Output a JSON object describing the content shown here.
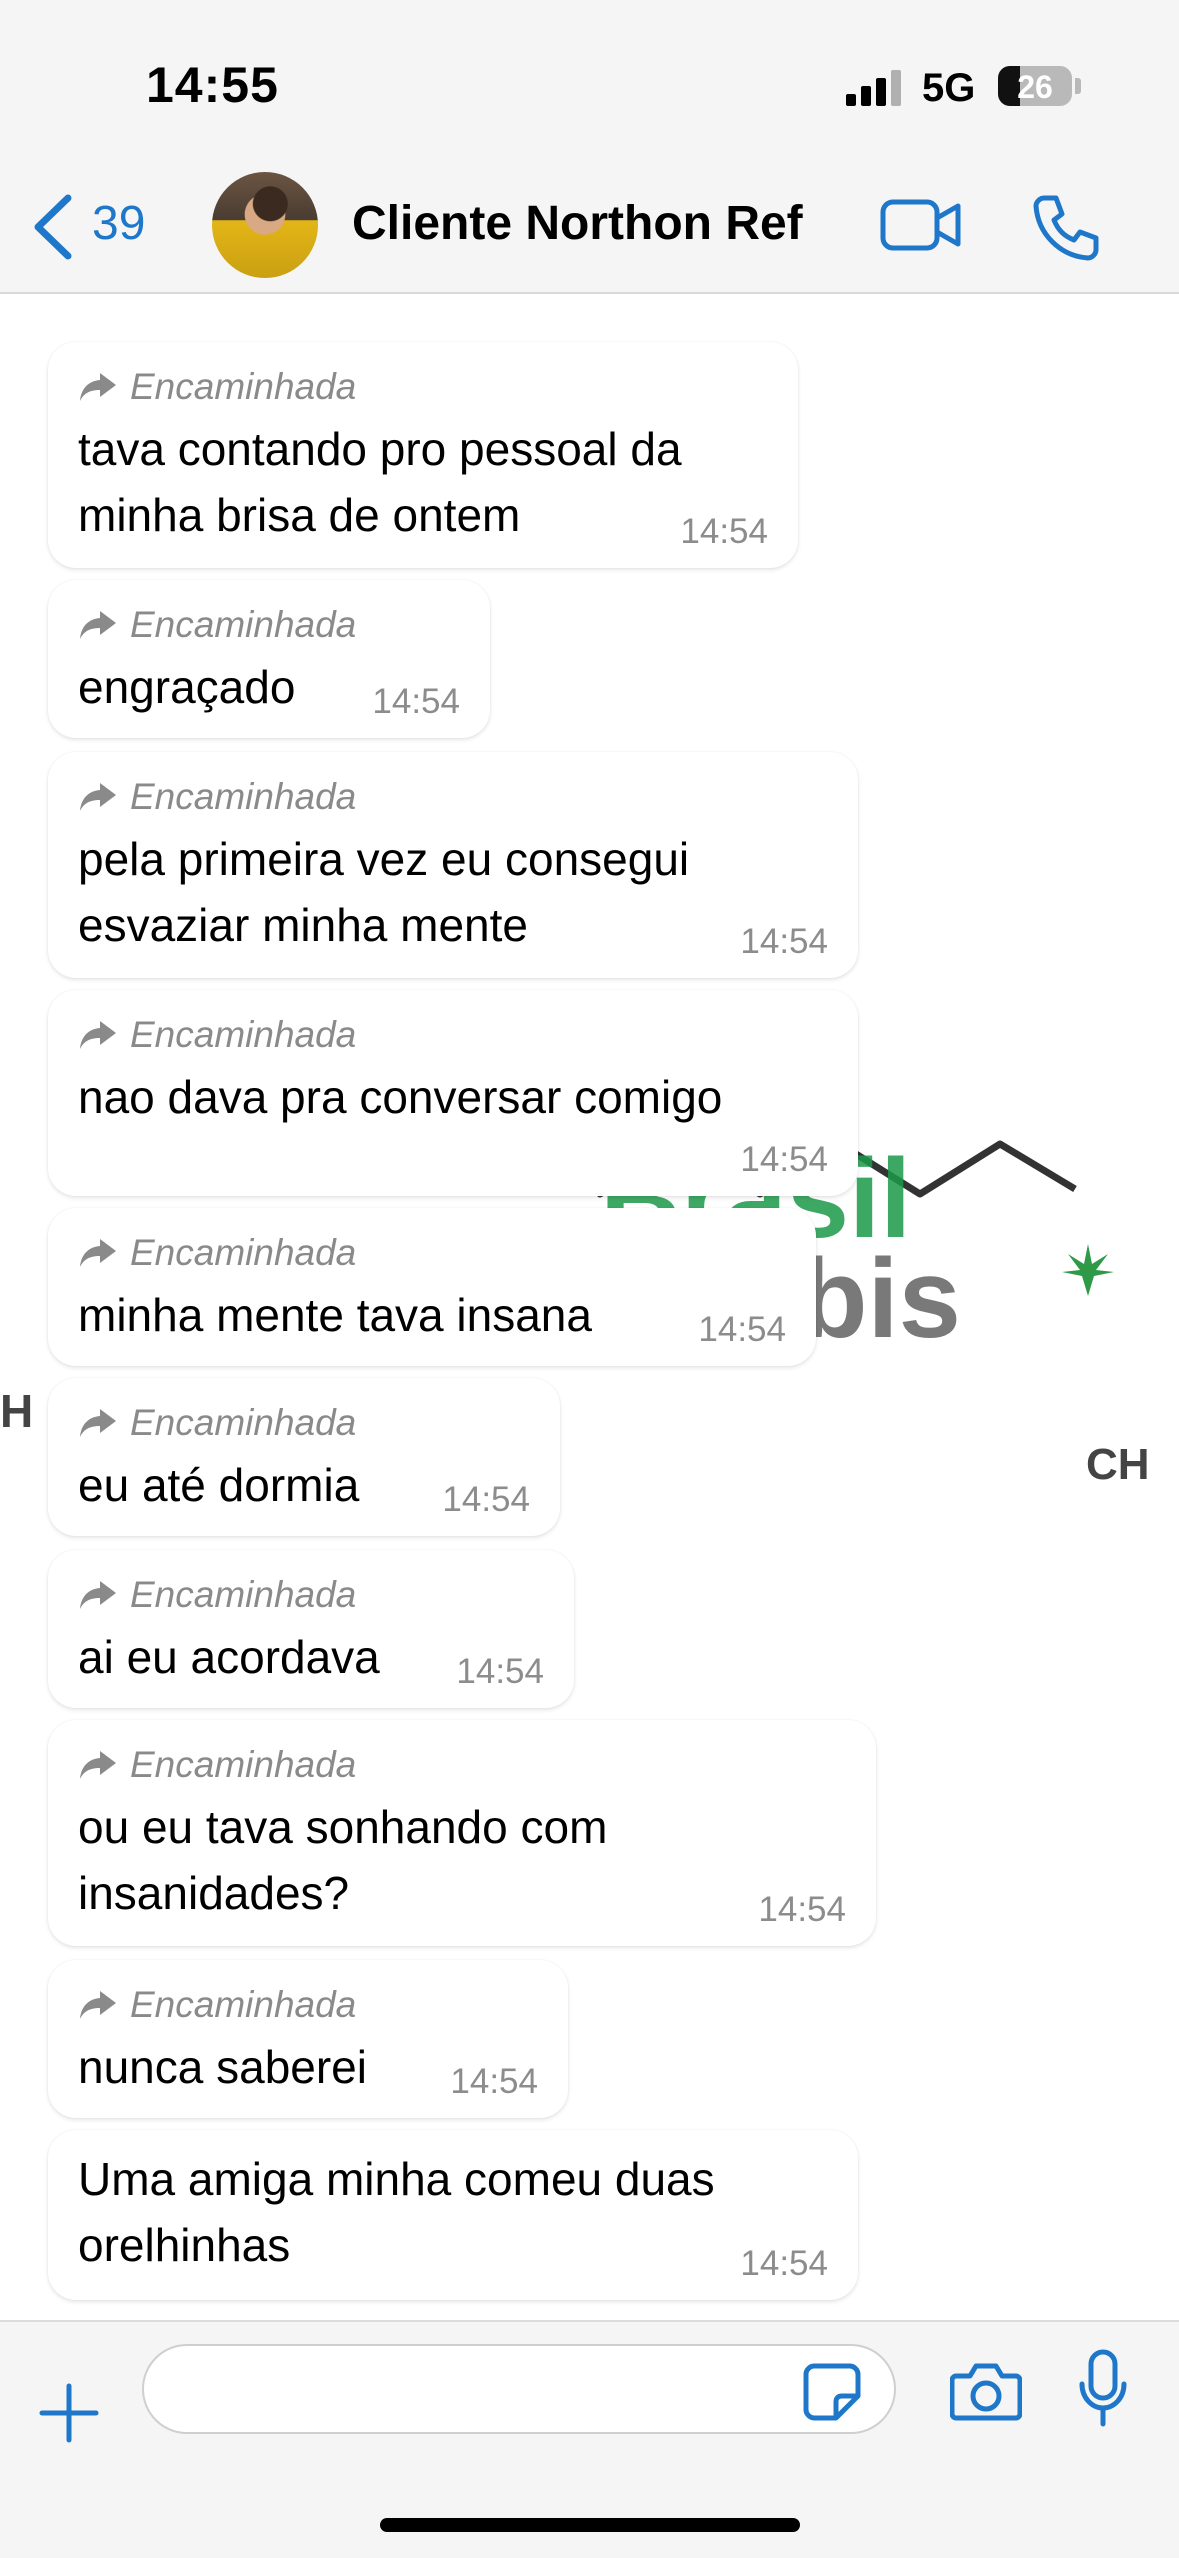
{
  "status_bar": {
    "time": "14:55",
    "network": "5G",
    "battery": "26"
  },
  "header": {
    "back_count": "39",
    "contact_name": "Cliente Northon Ref"
  },
  "forward_label": "Encaminhada",
  "watermark": {
    "title": "Brasil",
    "subtitle": "nnabis",
    "left_formula": "H",
    "right_formula": "CH"
  },
  "messages": [
    {
      "forwarded": true,
      "text": "tava contando pro pessoal da minha brisa de ontem",
      "time": "14:54"
    },
    {
      "forwarded": true,
      "text": "engraçado",
      "time": "14:54"
    },
    {
      "forwarded": true,
      "text": "pela primeira vez eu consegui esvaziar minha mente",
      "time": "14:54"
    },
    {
      "forwarded": true,
      "text": "nao dava pra conversar comigo",
      "time": "14:54"
    },
    {
      "forwarded": true,
      "text": "minha mente tava insana",
      "time": "14:54"
    },
    {
      "forwarded": true,
      "text": "eu até dormia",
      "time": "14:54"
    },
    {
      "forwarded": true,
      "text": "ai eu acordava",
      "time": "14:54"
    },
    {
      "forwarded": true,
      "text": "ou eu tava sonhando com insanidades?",
      "time": "14:54"
    },
    {
      "forwarded": true,
      "text": "nunca saberei",
      "time": "14:54"
    },
    {
      "forwarded": false,
      "text": "Uma amiga minha comeu duas orelhinhas",
      "time": "14:54"
    }
  ],
  "composer": {
    "placeholder": ""
  },
  "colors": {
    "accent": "#1f77c9",
    "watermark_green": "#1c9a4a"
  },
  "icons": [
    "back-chevron-icon",
    "video-call-icon",
    "phone-icon",
    "forward-arrow-icon",
    "plus-icon",
    "sticker-icon",
    "camera-icon",
    "microphone-icon"
  ]
}
